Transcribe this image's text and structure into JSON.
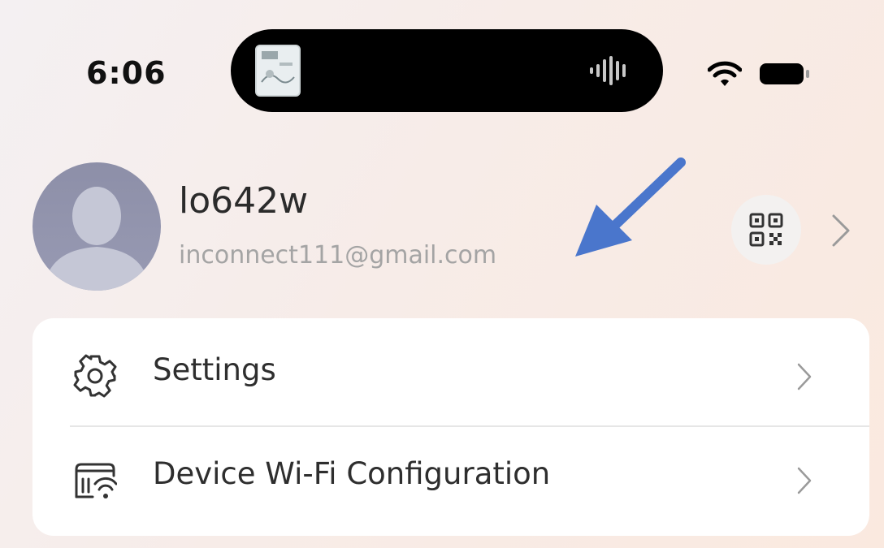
{
  "status_bar": {
    "time": "6:06",
    "icons": [
      "wifi-icon",
      "battery-icon"
    ]
  },
  "dynamic_island": {
    "icons": [
      "album-thumbnail",
      "audio-waveform-icon"
    ]
  },
  "profile": {
    "username": "lo642w",
    "email": "inconnect111@gmail.com",
    "icons": [
      "avatar",
      "qr-code-icon",
      "chevron-right-icon"
    ]
  },
  "annotation": {
    "arrow_color": "#4a76cc",
    "icon": "arrow-icon"
  },
  "menu": {
    "items": [
      {
        "label": "Settings",
        "icon": "gear-icon"
      },
      {
        "label": "Device Wi-Fi Configuration",
        "icon": "router-wifi-icon"
      }
    ]
  },
  "colors": {
    "text_primary": "#2b2b2b",
    "text_secondary": "#a4a4a4",
    "card": "#ffffff"
  }
}
